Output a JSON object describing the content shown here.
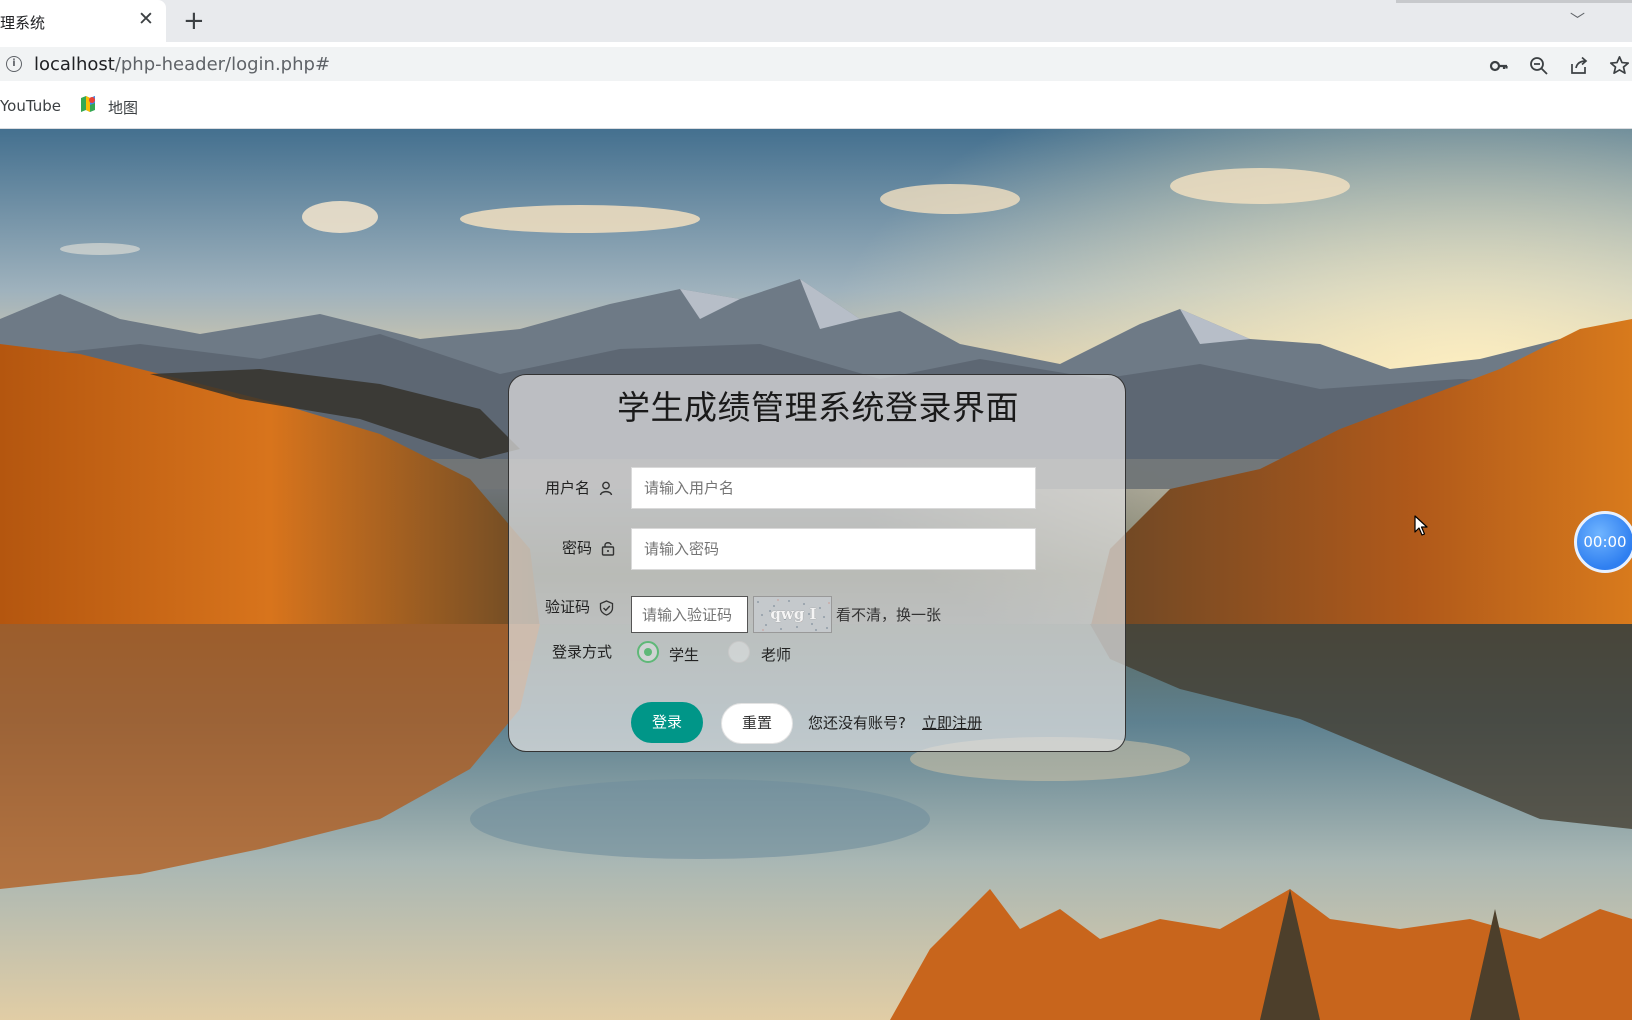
{
  "browser": {
    "tab_title": "理系统",
    "tab_close": "✕",
    "new_tab": "+",
    "tab_dropdown": "﹀",
    "url_host": "localhost",
    "url_path": "/php-header/login.php#",
    "icons": [
      "info-icon",
      "key-icon",
      "zoom-out-icon",
      "share-icon",
      "star-icon"
    ],
    "bookmarks": [
      {
        "label": "YouTube"
      },
      {
        "label": "地图",
        "icon": "maps-icon"
      }
    ]
  },
  "login": {
    "title": "学生成绩管理系统登录界面",
    "username_label": "用户名",
    "username_placeholder": "请输入用户名",
    "password_label": "密码",
    "password_placeholder": "请输入密码",
    "captcha_label": "验证码",
    "captcha_placeholder": "请输入验证码",
    "captcha_text": "qwg I",
    "captcha_refresh": "看不清，换一张",
    "login_type_label": "登录方式",
    "login_types": [
      {
        "label": "学生",
        "checked": true
      },
      {
        "label": "老师",
        "checked": false
      }
    ],
    "login_button": "登录",
    "reset_button": "重置",
    "no_account_text": "您还没有账号?",
    "register_link": "立即注册"
  },
  "timer": "00:00",
  "colors": {
    "primary": "#009688",
    "radio_checked": "#5fb878",
    "timer_blue": "#2f7ff0"
  }
}
